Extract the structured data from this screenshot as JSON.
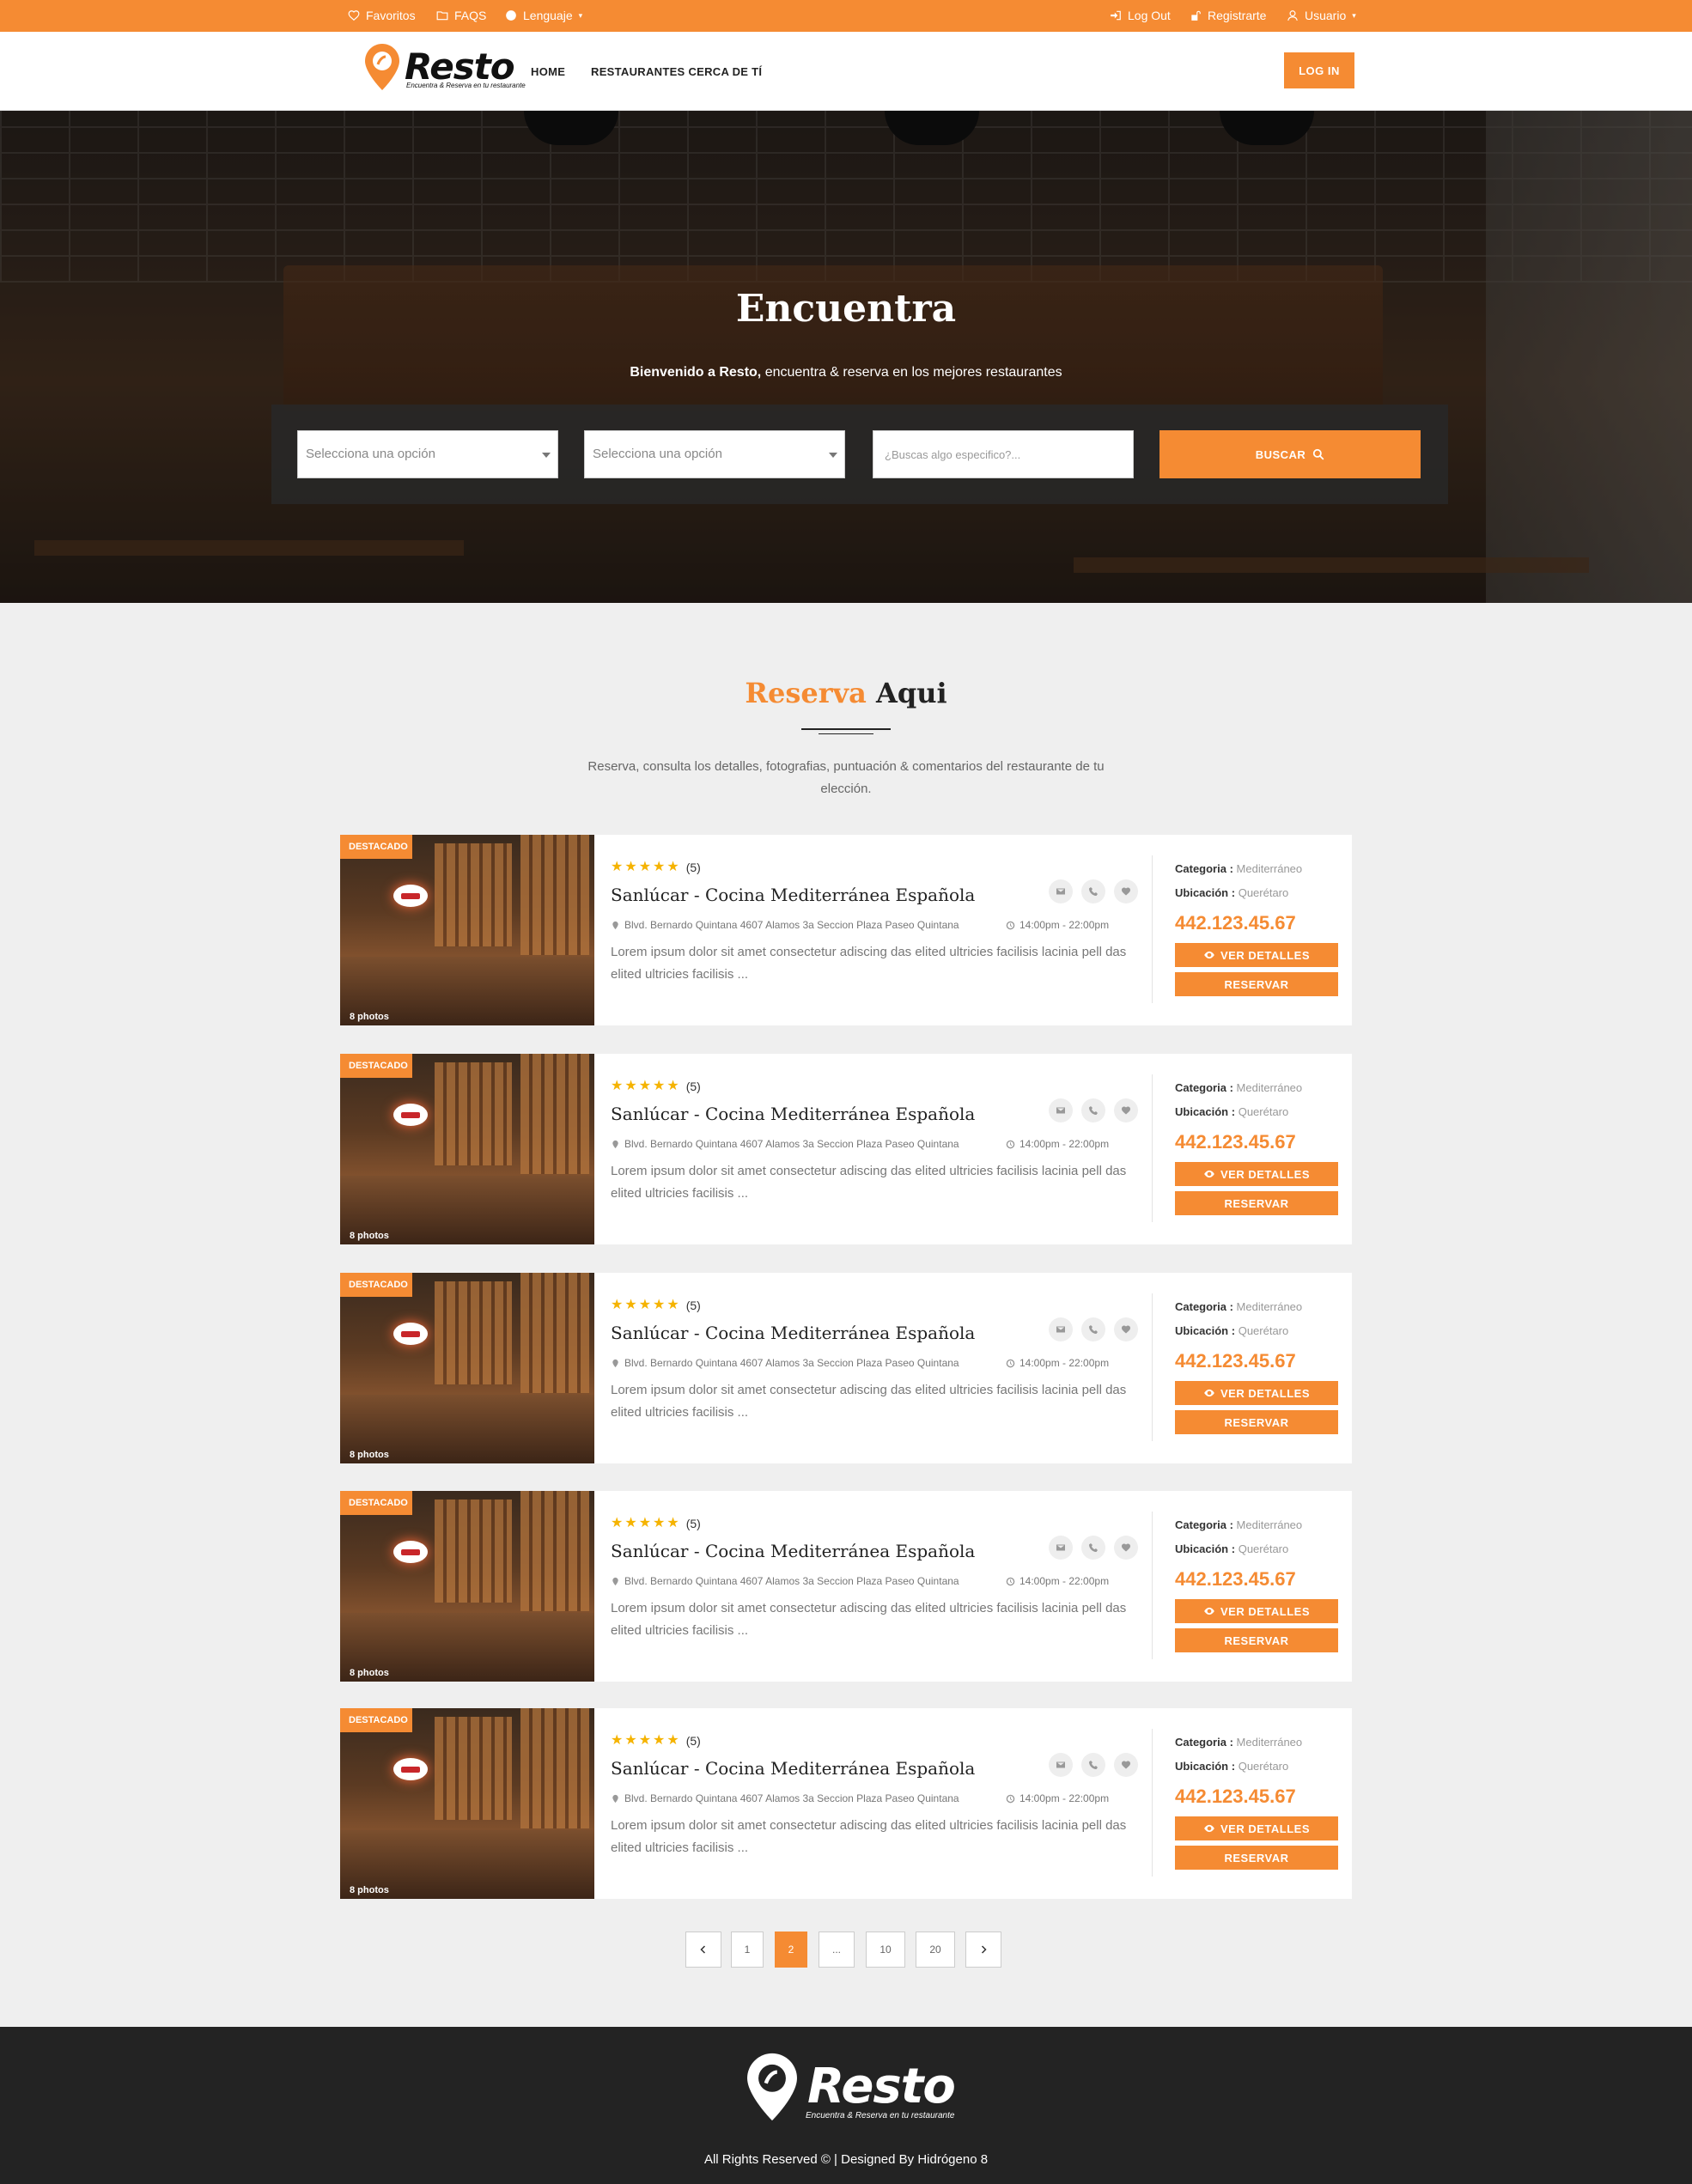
{
  "topbar": {
    "favoritos": "Favoritos",
    "faqs": "FAQS",
    "lenguaje": "Lenguaje",
    "logout": "Log Out",
    "registrarte": "Registrarte",
    "usuario": "Usuario"
  },
  "brand": {
    "name": "Resto",
    "tagline": "Encuentra & Reserva en tu restaurante",
    "accent": "#f58b33"
  },
  "nav": {
    "home": "HOME",
    "cerca": "RESTAURANTES CERCA DE TÍ",
    "login": "LOG IN"
  },
  "hero": {
    "title": "Encuentra",
    "sub_bold": "Bienvenido a Resto,",
    "sub_rest": " encuentra & reserva en los mejores restaurantes",
    "select1": "Selecciona una opción",
    "select2": "Selecciona una opción",
    "search_placeholder": "¿Buscas algo especifico?...",
    "search_button": "BUSCAR"
  },
  "section": {
    "title_orange": "Reserva",
    "title_dark": " Aqui",
    "desc": "Reserva, consulta los detalles, fotografias, puntuación & comentarios del restaurante de tu elección."
  },
  "listings": [
    {
      "badge": "DESTACADO",
      "photos": "8 photos",
      "rating_count": "(5)",
      "name": "Sanlúcar - Cocina Mediterránea Española",
      "address": "Blvd. Bernardo Quintana 4607 Alamos 3a Seccion Plaza Paseo Quintana",
      "hours": "14:00pm - 22:00pm",
      "desc": "Lorem ipsum dolor sit amet consectetur adiscing das elited ultricies facilisis lacinia pell das elited ultricies facilisis ...",
      "categoria_label": "Categoria :",
      "categoria": "Mediterráneo",
      "ubicacion_label": "Ubicación :",
      "ubicacion": "Querétaro",
      "phone": "442.123.45.67",
      "ver": "VER DETALLES",
      "reservar": "RESERVAR"
    },
    {
      "badge": "DESTACADO",
      "photos": "8 photos",
      "rating_count": "(5)",
      "name": "Sanlúcar - Cocina Mediterránea Española",
      "address": "Blvd. Bernardo Quintana 4607 Alamos 3a Seccion Plaza Paseo Quintana",
      "hours": "14:00pm - 22:00pm",
      "desc": "Lorem ipsum dolor sit amet consectetur adiscing das elited ultricies facilisis lacinia pell das elited ultricies facilisis ...",
      "categoria_label": "Categoria :",
      "categoria": "Mediterráneo",
      "ubicacion_label": "Ubicación :",
      "ubicacion": "Querétaro",
      "phone": "442.123.45.67",
      "ver": "VER DETALLES",
      "reservar": "RESERVAR"
    },
    {
      "badge": "DESTACADO",
      "photos": "8 photos",
      "rating_count": "(5)",
      "name": "Sanlúcar - Cocina Mediterránea Española",
      "address": "Blvd. Bernardo Quintana 4607 Alamos 3a Seccion Plaza Paseo Quintana",
      "hours": "14:00pm - 22:00pm",
      "desc": "Lorem ipsum dolor sit amet consectetur adiscing das elited ultricies facilisis lacinia pell das elited ultricies facilisis ...",
      "categoria_label": "Categoria :",
      "categoria": "Mediterráneo",
      "ubicacion_label": "Ubicación :",
      "ubicacion": "Querétaro",
      "phone": "442.123.45.67",
      "ver": "VER DETALLES",
      "reservar": "RESERVAR"
    },
    {
      "badge": "DESTACADO",
      "photos": "8 photos",
      "rating_count": "(5)",
      "name": "Sanlúcar - Cocina Mediterránea Española",
      "address": "Blvd. Bernardo Quintana 4607 Alamos 3a Seccion Plaza Paseo Quintana",
      "hours": "14:00pm - 22:00pm",
      "desc": "Lorem ipsum dolor sit amet consectetur adiscing das elited ultricies facilisis lacinia pell das elited ultricies facilisis ...",
      "categoria_label": "Categoria :",
      "categoria": "Mediterráneo",
      "ubicacion_label": "Ubicación :",
      "ubicacion": "Querétaro",
      "phone": "442.123.45.67",
      "ver": "VER DETALLES",
      "reservar": "RESERVAR"
    },
    {
      "badge": "DESTACADO",
      "photos": "8 photos",
      "rating_count": "(5)",
      "name": "Sanlúcar - Cocina Mediterránea Española",
      "address": "Blvd. Bernardo Quintana 4607 Alamos 3a Seccion Plaza Paseo Quintana",
      "hours": "14:00pm - 22:00pm",
      "desc": "Lorem ipsum dolor sit amet consectetur adiscing das elited ultricies facilisis lacinia pell das elited ultricies facilisis ...",
      "categoria_label": "Categoria :",
      "categoria": "Mediterráneo",
      "ubicacion_label": "Ubicación :",
      "ubicacion": "Querétaro",
      "phone": "442.123.45.67",
      "ver": "VER DETALLES",
      "reservar": "RESERVAR"
    }
  ],
  "rating_stars": 5,
  "pagination": {
    "pages": [
      "1",
      "2",
      "...",
      "10",
      "20"
    ],
    "current": "2"
  },
  "footer": {
    "copyright": "All Rights Reserved © | Designed By Hidrógeno 8"
  }
}
